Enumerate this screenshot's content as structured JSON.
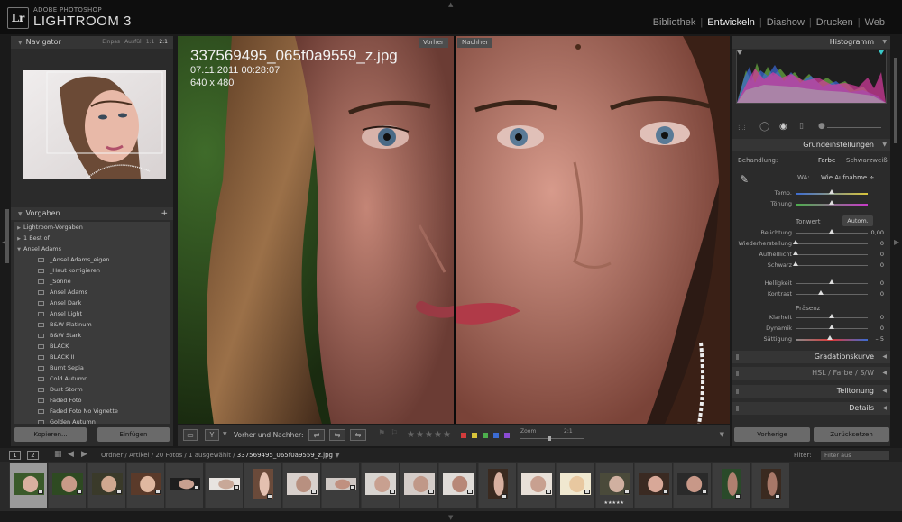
{
  "app": {
    "brand_small": "ADOBE PHOTOSHOP",
    "brand_big": "LIGHTROOM 3",
    "logo": "Lr"
  },
  "modules": [
    "Bibliothek",
    "Entwickeln",
    "Diashow",
    "Drucken",
    "Web"
  ],
  "active_module": "Entwickeln",
  "navigator": {
    "title": "Navigator",
    "options": [
      "Einpas",
      "Ausfül",
      "1:1",
      "2:1"
    ],
    "active_option": "2:1"
  },
  "presets": {
    "title": "Vorgaben",
    "add": "+",
    "items": [
      {
        "label": "Lightroom-Vorgaben",
        "kind": "folder"
      },
      {
        "label": "1 Best of",
        "kind": "folder"
      },
      {
        "label": "Ansel Adams",
        "kind": "folder-open"
      },
      {
        "label": "_Ansel Adams_eigen",
        "kind": "preset"
      },
      {
        "label": "_Haut korrigieren",
        "kind": "preset"
      },
      {
        "label": "_Sonne",
        "kind": "preset"
      },
      {
        "label": "Ansel Adams",
        "kind": "preset"
      },
      {
        "label": "Ansel Dark",
        "kind": "preset"
      },
      {
        "label": "Ansel Light",
        "kind": "preset"
      },
      {
        "label": "B&W Platinum",
        "kind": "preset"
      },
      {
        "label": "B&W Stark",
        "kind": "preset"
      },
      {
        "label": "BLACK",
        "kind": "preset"
      },
      {
        "label": "BLACK II",
        "kind": "preset"
      },
      {
        "label": "Burnt Sepia",
        "kind": "preset"
      },
      {
        "label": "Cold Autumn",
        "kind": "preset"
      },
      {
        "label": "Dust Storm",
        "kind": "preset"
      },
      {
        "label": "Faded Foto",
        "kind": "preset"
      },
      {
        "label": "Faded Foto No Vignette",
        "kind": "preset"
      },
      {
        "label": "Golden Autumn",
        "kind": "preset"
      }
    ]
  },
  "left_buttons": {
    "copy": "Kopieren...",
    "paste": "Einfügen"
  },
  "photo": {
    "filename": "337569495_065f0a9559_z.jpg",
    "datetime": "07.11.2011 00:28:07",
    "dimensions": "640 x 480",
    "before_tag": "Vorher",
    "after_tag": "Nachher"
  },
  "toolbar": {
    "before_after_label": "Vorher und Nachher:",
    "zoom_label": "Zoom",
    "zoom_value": "2:1",
    "stars": [
      "★",
      "★",
      "★",
      "★",
      "★"
    ],
    "color_labels": [
      "#d23b3b",
      "#d8c43a",
      "#4cae4c",
      "#3b6bd2",
      "#8a4bd2"
    ]
  },
  "right": {
    "histogram_title": "Histogramm",
    "basic_title": "Grundeinstellungen",
    "treatment_label": "Behandlung:",
    "treatment_color": "Farbe",
    "treatment_bw": "Schwarzweiß",
    "wb_label": "WA:",
    "wb_value": "Wie Aufnahme ÷",
    "tone_label": "Tonwert",
    "auto_label": "Autom.",
    "presence_label": "Präsenz",
    "sliders_wb": [
      {
        "label": "Temp.",
        "value": "",
        "pos": 0.5
      },
      {
        "label": "Tönung",
        "value": "",
        "pos": 0.5
      }
    ],
    "sliders_tone": [
      {
        "label": "Belichtung",
        "value": "0,00",
        "pos": 0.5
      },
      {
        "label": "Wiederherstellung",
        "value": "0",
        "pos": 0.0
      },
      {
        "label": "Aufhelllicht",
        "value": "0",
        "pos": 0.0
      },
      {
        "label": "Schwarz",
        "value": "0",
        "pos": 0.0
      },
      {
        "label": "Helligkeit",
        "value": "0",
        "pos": 0.5
      },
      {
        "label": "Kontrast",
        "value": "0",
        "pos": 0.35
      }
    ],
    "sliders_presence": [
      {
        "label": "Klarheit",
        "value": "0",
        "pos": 0.5
      },
      {
        "label": "Dynamik",
        "value": "0",
        "pos": 0.5
      },
      {
        "label": "Sättigung",
        "value": "– 5",
        "pos": 0.48
      }
    ],
    "sections": [
      "Gradationskurve",
      "HSL / Farbe / S/W",
      "Teiltonung",
      "Details"
    ],
    "prev_button": "Vorherige",
    "reset_button": "Zurücksetzen"
  },
  "filmstrip": {
    "screen1": "1",
    "screen2": "2",
    "path_prefix": "Ordner / Artikel / 20 Fotos / 1 ausgewählt /",
    "path_file": "337569495_065f0a9559_z.jpg",
    "filter_label": "Filter:",
    "filter_value": "Filter aus",
    "thumb_count": 20,
    "selected_index": 0,
    "rated_index": 15,
    "rated_stars": "★★★★★"
  }
}
